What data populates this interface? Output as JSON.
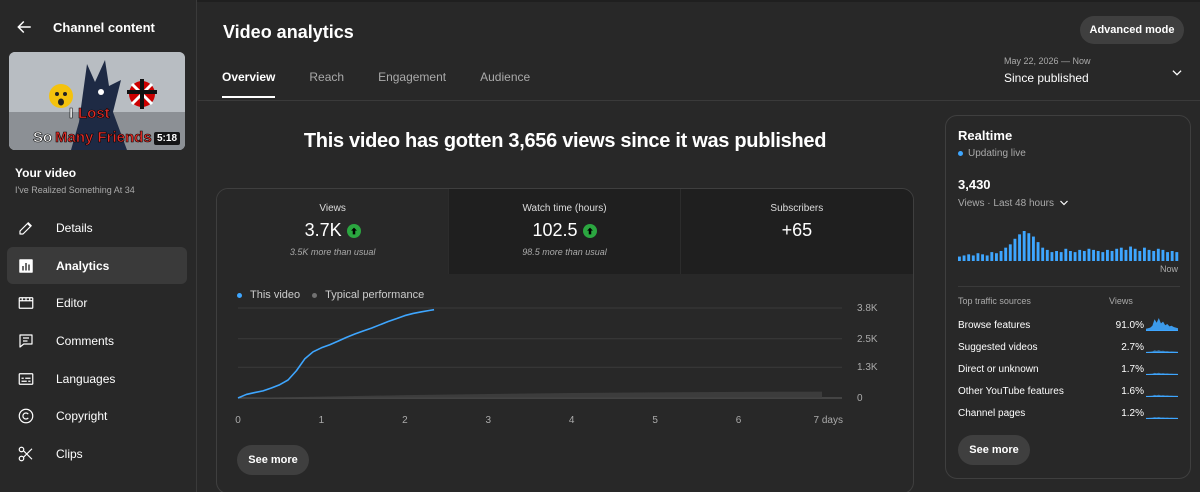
{
  "sidebar": {
    "title": "Channel content",
    "thumbnail": {
      "duration": "5:18"
    },
    "your_video": "Your video",
    "video_title": "I've Realized Something At 34",
    "nav": [
      {
        "label": "Details",
        "icon": "pencil-icon"
      },
      {
        "label": "Analytics",
        "icon": "analytics-icon",
        "active": true
      },
      {
        "label": "Editor",
        "icon": "editor-icon"
      },
      {
        "label": "Comments",
        "icon": "comments-icon"
      },
      {
        "label": "Languages",
        "icon": "subtitles-icon"
      },
      {
        "label": "Copyright",
        "icon": "copyright-icon"
      },
      {
        "label": "Clips",
        "icon": "scissors-icon"
      }
    ]
  },
  "header": {
    "title": "Video analytics",
    "advanced_mode": "Advanced mode",
    "tabs": [
      "Overview",
      "Reach",
      "Engagement",
      "Audience"
    ],
    "date_range": "May 22, 2026 — Now",
    "date_value": "Since published"
  },
  "headline": "This video has gotten 3,656 views since it was published",
  "metrics": [
    {
      "label": "Views",
      "value": "3.7K",
      "sub": "3.5K more than usual",
      "trend": "up"
    },
    {
      "label": "Watch time (hours)",
      "value": "102.5",
      "sub": "98.5 more than usual",
      "trend": "up"
    },
    {
      "label": "Subscribers",
      "value": "+65"
    }
  ],
  "legend": {
    "this_video": "This video",
    "typical": "Typical performance"
  },
  "see_more": "See more",
  "colors": {
    "accent": "#3ea6ff",
    "up": "#2ba640",
    "typical_band": "#3f3f3f"
  },
  "chart_data": {
    "type": "line",
    "x_ticks": [
      "0",
      "1",
      "2",
      "3",
      "4",
      "5",
      "6",
      "7 days"
    ],
    "y_ticks": [
      "0",
      "1.3K",
      "2.5K",
      "3.8K"
    ],
    "xlim": [
      0,
      7
    ],
    "ylim": [
      0,
      3800
    ],
    "series": [
      {
        "name": "This video",
        "x": [
          0,
          0.1,
          0.2,
          0.3,
          0.4,
          0.5,
          0.6,
          0.7,
          0.8,
          0.9,
          1.0,
          1.1,
          1.2,
          1.3,
          1.4,
          1.5,
          1.6,
          1.7,
          1.8,
          1.9,
          2.0,
          2.1,
          2.2,
          2.3,
          2.35
        ],
        "y": [
          0,
          150,
          230,
          300,
          420,
          560,
          760,
          1150,
          1650,
          1950,
          2120,
          2250,
          2400,
          2560,
          2700,
          2830,
          2950,
          3090,
          3230,
          3350,
          3480,
          3570,
          3640,
          3700,
          3730
        ]
      },
      {
        "name": "Typical performance",
        "x": [
          0,
          1,
          2,
          3,
          4,
          5,
          6,
          7
        ],
        "y": [
          0,
          60,
          120,
          170,
          210,
          240,
          260,
          270
        ]
      }
    ]
  },
  "realtime": {
    "title": "Realtime",
    "status": "Updating live",
    "count": "3,430",
    "range": "Views · Last 48 hours",
    "now": "Now",
    "bars": [
      4,
      5,
      6,
      5,
      7,
      6,
      5,
      8,
      7,
      9,
      12,
      15,
      20,
      24,
      27,
      25,
      22,
      17,
      12,
      10,
      8,
      9,
      8,
      11,
      9,
      8,
      10,
      9,
      11,
      10,
      9,
      8,
      10,
      9,
      11,
      12,
      10,
      13,
      11,
      9,
      12,
      10,
      9,
      11,
      10,
      8,
      9,
      8
    ],
    "sources_header": "Top traffic sources",
    "views_header": "Views",
    "sources": [
      {
        "name": "Browse features",
        "pct": "91.0%",
        "level": 1.0
      },
      {
        "name": "Suggested videos",
        "pct": "2.7%",
        "level": 0.15
      },
      {
        "name": "Direct or unknown",
        "pct": "1.7%",
        "level": 0.1
      },
      {
        "name": "Other YouTube features",
        "pct": "1.6%",
        "level": 0.1
      },
      {
        "name": "Channel pages",
        "pct": "1.2%",
        "level": 0.08
      }
    ]
  }
}
